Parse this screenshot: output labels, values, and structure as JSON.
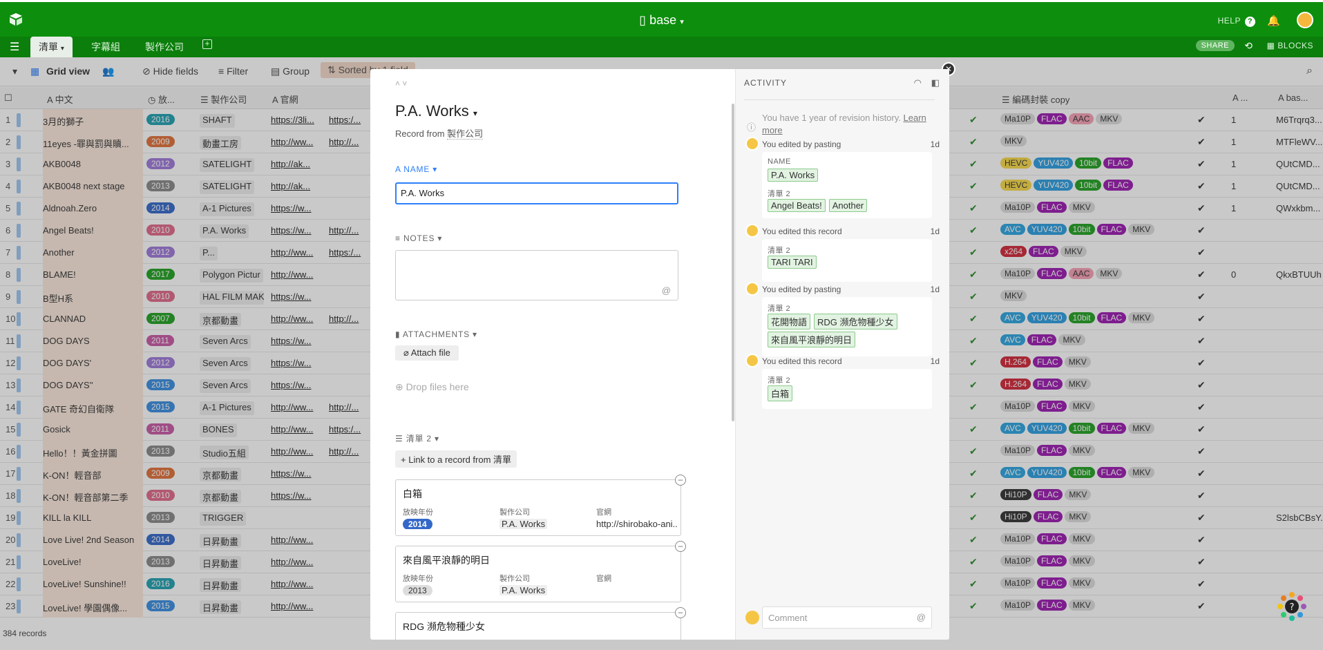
{
  "app": {
    "title": "base",
    "help": "HELP",
    "share": "SHARE",
    "blocks": "BLOCKS"
  },
  "tabs": [
    "清單",
    "字幕組",
    "製作公司"
  ],
  "toolbar": {
    "view": "Grid view",
    "hide_fields": "Hide fields",
    "filter": "Filter",
    "group": "Group",
    "sorted": "Sorted by 1 field",
    "records": "384 records"
  },
  "headers": {
    "name": "中文",
    "year": "放...",
    "company": "製作公司",
    "site": "官網",
    "codec": "編碼封裝 copy",
    "num": "...",
    "b64": "bas..."
  },
  "colors": {
    "top": "#0d8f0d",
    "tabs": "#0b7e0b",
    "accent": "#2d7ff9"
  },
  "rows": [
    {
      "n": "1",
      "name": "3月的獅子",
      "year": "2016",
      "yc": "#20a0b0",
      "co": "SHAFT",
      "u1": "https://3li...",
      "u2": "https:/...",
      "tags": [
        [
          "Ma10P",
          "#ddd",
          "#333"
        ],
        [
          "FLAC",
          "#9b1bb0",
          "#fff"
        ],
        [
          "AAC",
          "#f6a0b6",
          "#333"
        ],
        [
          "MKV",
          "#ddd",
          "#333"
        ]
      ],
      "num": "1",
      "b64": "M6Trqrq3..."
    },
    {
      "n": "2",
      "name": "11eyes -罪與罰與贖...",
      "year": "2009",
      "yc": "#e0703a",
      "co": "動畫工房",
      "u1": "http://ww...",
      "u2": "http://...",
      "tags": [
        [
          "MKV",
          "#ddd",
          "#333"
        ]
      ],
      "num": "1",
      "b64": "MTFleWV..."
    },
    {
      "n": "3",
      "name": "AKB0048",
      "year": "2012",
      "yc": "#9e78d8",
      "co": "SATELIGHT",
      "u1": "http://ak...",
      "u2": "",
      "tags": [
        [
          "HEVC",
          "#f7d94a",
          "#333"
        ],
        [
          "YUV420",
          "#2d9ee0",
          "#fff"
        ],
        [
          "10bit",
          "#22a022",
          "#fff"
        ],
        [
          "FLAC",
          "#9b1bb0",
          "#fff"
        ]
      ],
      "num": "1",
      "b64": "QUtCMD..."
    },
    {
      "n": "4",
      "name": "AKB0048 next stage",
      "year": "2013",
      "yc": "#888",
      "co": "SATELIGHT",
      "u1": "http://ak...",
      "u2": "",
      "tags": [
        [
          "HEVC",
          "#f7d94a",
          "#333"
        ],
        [
          "YUV420",
          "#2d9ee0",
          "#fff"
        ],
        [
          "10bit",
          "#22a022",
          "#fff"
        ],
        [
          "FLAC",
          "#9b1bb0",
          "#fff"
        ]
      ],
      "num": "1",
      "b64": "QUtCMD..."
    },
    {
      "n": "5",
      "name": "Aldnoah.Zero",
      "year": "2014",
      "yc": "#3468c8",
      "co": "A-1 Pictures",
      "u1": "https://w...",
      "u2": "",
      "tags": [
        [
          "Ma10P",
          "#ddd",
          "#333"
        ],
        [
          "FLAC",
          "#9b1bb0",
          "#fff"
        ],
        [
          "MKV",
          "#ddd",
          "#333"
        ]
      ],
      "num": "1",
      "b64": "QWxkbm..."
    },
    {
      "n": "6",
      "name": "Angel Beats!",
      "year": "2010",
      "yc": "#e06a8a",
      "co": "P.A. Works",
      "u1": "https://w...",
      "u2": "http://...",
      "tags": [
        [
          "AVC",
          "#2da5e0",
          "#fff"
        ],
        [
          "YUV420",
          "#2d9ee0",
          "#fff"
        ],
        [
          "10bit",
          "#22a022",
          "#fff"
        ],
        [
          "FLAC",
          "#9b1bb0",
          "#fff"
        ],
        [
          "MKV",
          "#ddd",
          "#333"
        ]
      ],
      "num": "",
      "b64": ""
    },
    {
      "n": "7",
      "name": "Another",
      "year": "2012",
      "yc": "#9e78d8",
      "co": "P...",
      "u1": "http://ww...",
      "u2": "https:/...",
      "tags": [
        [
          "x264",
          "#d0283a",
          "#fff"
        ],
        [
          "FLAC",
          "#9b1bb0",
          "#fff"
        ],
        [
          "MKV",
          "#ddd",
          "#333"
        ]
      ],
      "num": "",
      "b64": ""
    },
    {
      "n": "8",
      "name": "BLAME!",
      "year": "2017",
      "yc": "#22a022",
      "co": "Polygon Pictur",
      "u1": "http://ww...",
      "u2": "",
      "tags": [
        [
          "Ma10P",
          "#ddd",
          "#333"
        ],
        [
          "FLAC",
          "#9b1bb0",
          "#fff"
        ],
        [
          "AAC",
          "#f6a0b6",
          "#333"
        ],
        [
          "MKV",
          "#ddd",
          "#333"
        ]
      ],
      "num": "0",
      "b64": "QkxBTUUh"
    },
    {
      "n": "9",
      "name": "B型H系",
      "year": "2010",
      "yc": "#e06a8a",
      "co": "HAL FILM MAK",
      "u1": "https://w...",
      "u2": "",
      "tags": [
        [
          "MKV",
          "#ddd",
          "#333"
        ]
      ],
      "num": "",
      "b64": ""
    },
    {
      "n": "10",
      "name": "CLANNAD",
      "year": "2007",
      "yc": "#22a022",
      "co": "京都動畫",
      "u1": "http://ww...",
      "u2": "http://...",
      "tags": [
        [
          "AVC",
          "#2da5e0",
          "#fff"
        ],
        [
          "YUV420",
          "#2d9ee0",
          "#fff"
        ],
        [
          "10bit",
          "#22a022",
          "#fff"
        ],
        [
          "FLAC",
          "#9b1bb0",
          "#fff"
        ],
        [
          "MKV",
          "#ddd",
          "#333"
        ]
      ],
      "num": "",
      "b64": ""
    },
    {
      "n": "11",
      "name": "DOG DAYS",
      "year": "2011",
      "yc": "#c85aa6",
      "co": "Seven Arcs",
      "u1": "https://w...",
      "u2": "",
      "tags": [
        [
          "AVC",
          "#2da5e0",
          "#fff"
        ],
        [
          "FLAC",
          "#9b1bb0",
          "#fff"
        ],
        [
          "MKV",
          "#ddd",
          "#333"
        ]
      ],
      "num": "",
      "b64": ""
    },
    {
      "n": "12",
      "name": "DOG DAYS'",
      "year": "2012",
      "yc": "#9e78d8",
      "co": "Seven Arcs",
      "u1": "https://w...",
      "u2": "",
      "tags": [
        [
          "H.264",
          "#d0283a",
          "#fff"
        ],
        [
          "FLAC",
          "#9b1bb0",
          "#fff"
        ],
        [
          "MKV",
          "#ddd",
          "#333"
        ]
      ],
      "num": "",
      "b64": ""
    },
    {
      "n": "13",
      "name": "DOG DAYS''",
      "year": "2015",
      "yc": "#3a8ee0",
      "co": "Seven Arcs",
      "u1": "https://w...",
      "u2": "",
      "tags": [
        [
          "H.264",
          "#d0283a",
          "#fff"
        ],
        [
          "FLAC",
          "#9b1bb0",
          "#fff"
        ],
        [
          "MKV",
          "#ddd",
          "#333"
        ]
      ],
      "num": "",
      "b64": ""
    },
    {
      "n": "14",
      "name": "GATE 奇幻自衛隊",
      "year": "2015",
      "yc": "#3a8ee0",
      "co": "A-1 Pictures",
      "u1": "http://ww...",
      "u2": "http://...",
      "tags": [
        [
          "Ma10P",
          "#ddd",
          "#333"
        ],
        [
          "FLAC",
          "#9b1bb0",
          "#fff"
        ],
        [
          "MKV",
          "#ddd",
          "#333"
        ]
      ],
      "num": "",
      "b64": ""
    },
    {
      "n": "15",
      "name": "Gosick",
      "year": "2011",
      "yc": "#c85aa6",
      "co": "BONES",
      "u1": "http://ww...",
      "u2": "https:/...",
      "tags": [
        [
          "AVC",
          "#2da5e0",
          "#fff"
        ],
        [
          "YUV420",
          "#2d9ee0",
          "#fff"
        ],
        [
          "10bit",
          "#22a022",
          "#fff"
        ],
        [
          "FLAC",
          "#9b1bb0",
          "#fff"
        ],
        [
          "MKV",
          "#ddd",
          "#333"
        ]
      ],
      "num": "",
      "b64": ""
    },
    {
      "n": "16",
      "name": "Hello！！黃金拼圖",
      "year": "2013",
      "yc": "#888",
      "co": "Studio五組",
      "u1": "http://ww...",
      "u2": "http://...",
      "tags": [
        [
          "Ma10P",
          "#ddd",
          "#333"
        ],
        [
          "FLAC",
          "#9b1bb0",
          "#fff"
        ],
        [
          "MKV",
          "#ddd",
          "#333"
        ]
      ],
      "num": "",
      "b64": ""
    },
    {
      "n": "17",
      "name": "K-ON！輕音部",
      "year": "2009",
      "yc": "#e0703a",
      "co": "京都動畫",
      "u1": "https://w...",
      "u2": "",
      "tags": [
        [
          "AVC",
          "#2da5e0",
          "#fff"
        ],
        [
          "YUV420",
          "#2d9ee0",
          "#fff"
        ],
        [
          "10bit",
          "#22a022",
          "#fff"
        ],
        [
          "FLAC",
          "#9b1bb0",
          "#fff"
        ],
        [
          "MKV",
          "#ddd",
          "#333"
        ]
      ],
      "num": "",
      "b64": ""
    },
    {
      "n": "18",
      "name": "K-ON！輕音部第二季",
      "year": "2010",
      "yc": "#e06a8a",
      "co": "京都動畫",
      "u1": "https://w...",
      "u2": "",
      "tags": [
        [
          "Hi10P",
          "#333",
          "#fff"
        ],
        [
          "FLAC",
          "#9b1bb0",
          "#fff"
        ],
        [
          "MKV",
          "#ddd",
          "#333"
        ]
      ],
      "num": "",
      "b64": ""
    },
    {
      "n": "19",
      "name": "KILL la KILL",
      "year": "2013",
      "yc": "#888",
      "co": "TRIGGER",
      "u1": "",
      "u2": "",
      "tags": [
        [
          "Hi10P",
          "#333",
          "#fff"
        ],
        [
          "FLAC",
          "#9b1bb0",
          "#fff"
        ],
        [
          "MKV",
          "#ddd",
          "#333"
        ]
      ],
      "num": "",
      "b64": "S2lsbCBsY..."
    },
    {
      "n": "20",
      "name": "Love Live! 2nd Season",
      "year": "2014",
      "yc": "#3468c8",
      "co": "日昇動畫",
      "u1": "http://ww...",
      "u2": "",
      "tags": [
        [
          "Ma10P",
          "#ddd",
          "#333"
        ],
        [
          "FLAC",
          "#9b1bb0",
          "#fff"
        ],
        [
          "MKV",
          "#ddd",
          "#333"
        ]
      ],
      "num": "",
      "b64": ""
    },
    {
      "n": "21",
      "name": "LoveLive!",
      "year": "2013",
      "yc": "#888",
      "co": "日昇動畫",
      "u1": "http://ww...",
      "u2": "",
      "tags": [
        [
          "Ma10P",
          "#ddd",
          "#333"
        ],
        [
          "FLAC",
          "#9b1bb0",
          "#fff"
        ],
        [
          "MKV",
          "#ddd",
          "#333"
        ]
      ],
      "num": "",
      "b64": ""
    },
    {
      "n": "22",
      "name": "LoveLive! Sunshine!!",
      "year": "2016",
      "yc": "#20a0b0",
      "co": "日昇動畫",
      "u1": "http://ww...",
      "u2": "",
      "tags": [
        [
          "Ma10P",
          "#ddd",
          "#333"
        ],
        [
          "FLAC",
          "#9b1bb0",
          "#fff"
        ],
        [
          "MKV",
          "#ddd",
          "#333"
        ]
      ],
      "num": "",
      "b64": ""
    },
    {
      "n": "23",
      "name": "LoveLive! 學園偶像...",
      "year": "2015",
      "yc": "#3a8ee0",
      "co": "日昇動畫",
      "u1": "http://ww...",
      "u2": "",
      "tags": [
        [
          "Ma10P",
          "#ddd",
          "#333"
        ],
        [
          "FLAC",
          "#9b1bb0",
          "#fff"
        ],
        [
          "MKV",
          "#ddd",
          "#333"
        ]
      ],
      "num": "",
      "b64": ""
    }
  ],
  "record": {
    "title": "P.A. Works",
    "from_prefix": "Record from",
    "from_table": "製作公司",
    "name_label": "NAME",
    "name_value": "P.A. Works",
    "notes_label": "NOTES",
    "attach_label": "ATTACHMENTS",
    "attach_btn": "Attach file",
    "drop": "Drop files here",
    "linked_label": "清單 2",
    "link_btn": "Link to a record from 清單",
    "cards": [
      {
        "title": "白箱",
        "l1": "放映年份",
        "l2": "製作公司",
        "l3": "官網",
        "year": "2014",
        "yc": "#3468c8",
        "co": "P.A. Works",
        "site": "http://shirobako-ani..."
      },
      {
        "title": "來自風平浪靜的明日",
        "l1": "放映年份",
        "l2": "製作公司",
        "l3": "官網",
        "year": "2013",
        "yc": "#ddd",
        "co": "P.A. Works",
        "site": ""
      },
      {
        "title": "RDG 瀕危物種少女",
        "l1": "",
        "l2": "",
        "l3": "",
        "year": "",
        "yc": "",
        "co": "",
        "site": ""
      }
    ]
  },
  "activity": {
    "title": "ACTIVITY",
    "revision": "You have 1 year of revision history.",
    "learn": "Learn more",
    "events": [
      {
        "head": "You edited by pasting",
        "time": "1d",
        "blocks": [
          {
            "label": "NAME",
            "chips": [
              "P.A. Works"
            ]
          },
          {
            "label": "清單 2",
            "chips": [
              "Angel Beats!",
              "Another"
            ]
          }
        ]
      },
      {
        "head": "You edited this record",
        "time": "1d",
        "blocks": [
          {
            "label": "清單 2",
            "chips": [
              "TARI TARI"
            ]
          }
        ]
      },
      {
        "head": "You edited by pasting",
        "time": "1d",
        "blocks": [
          {
            "label": "清單 2",
            "chips": [
              "花開物語",
              "RDG 瀕危物種少女",
              "來自風平浪靜的明日"
            ]
          }
        ]
      },
      {
        "head": "You edited this record",
        "time": "1d",
        "blocks": [
          {
            "label": "清單 2",
            "chips": [
              "白箱"
            ]
          }
        ]
      }
    ],
    "comment_placeholder": "Comment"
  }
}
